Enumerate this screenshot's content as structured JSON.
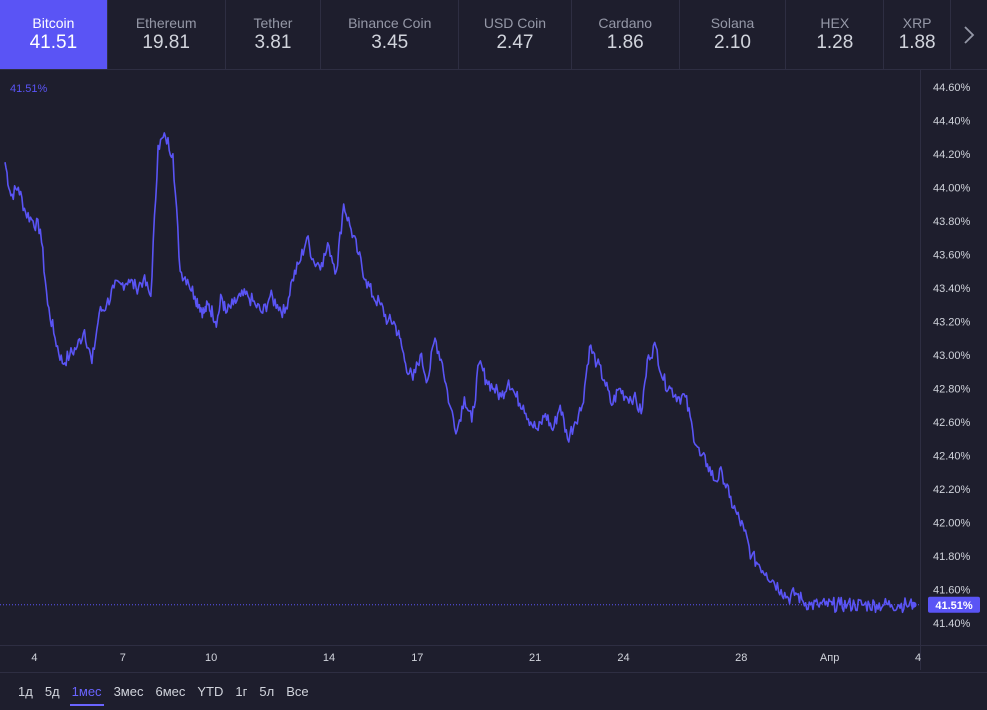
{
  "tabs": [
    {
      "name": "Bitcoin",
      "value": "41.51",
      "active": true
    },
    {
      "name": "Ethereum",
      "value": "19.81",
      "active": false
    },
    {
      "name": "Tether",
      "value": "3.81",
      "active": false
    },
    {
      "name": "Binance Coin",
      "value": "3.45",
      "active": false
    },
    {
      "name": "USD Coin",
      "value": "2.47",
      "active": false
    },
    {
      "name": "Cardano",
      "value": "1.86",
      "active": false
    },
    {
      "name": "Solana",
      "value": "2.10",
      "active": false
    },
    {
      "name": "HEX",
      "value": "1.28",
      "active": false
    },
    {
      "name": "XRP",
      "value": "1.88",
      "active": false
    }
  ],
  "next_icon": "chevron-right-icon",
  "ranges": [
    {
      "label": "1д",
      "active": false
    },
    {
      "label": "5д",
      "active": false
    },
    {
      "label": "1мес",
      "active": true
    },
    {
      "label": "3мес",
      "active": false
    },
    {
      "label": "6мес",
      "active": false
    },
    {
      "label": "YTD",
      "active": false
    },
    {
      "label": "1г",
      "active": false
    },
    {
      "label": "5л",
      "active": false
    },
    {
      "label": "Все",
      "active": false
    }
  ],
  "colors": {
    "line": "#5a54f5",
    "background": "#1e1e2d",
    "grid": "#2e2e42",
    "text": "#d1d4dc",
    "accent": "#5a54f5"
  },
  "chart_data": {
    "type": "line",
    "title": "",
    "xlabel": "",
    "ylabel": "",
    "legend_value": "41.51%",
    "last_value_label": "41.51%",
    "ylim": [
      41.27,
      44.7
    ],
    "xlim": [
      3,
      34.1
    ],
    "y_ticks": [
      "41.40%",
      "41.60%",
      "41.80%",
      "42.00%",
      "42.20%",
      "42.40%",
      "42.60%",
      "42.80%",
      "43.00%",
      "43.20%",
      "43.40%",
      "43.60%",
      "43.80%",
      "44.00%",
      "44.20%",
      "44.40%",
      "44.60%"
    ],
    "x_ticks": [
      {
        "at": 4,
        "label": "4"
      },
      {
        "at": 7,
        "label": "7"
      },
      {
        "at": 10,
        "label": "10"
      },
      {
        "at": 14,
        "label": "14"
      },
      {
        "at": 17,
        "label": "17"
      },
      {
        "at": 21,
        "label": "21"
      },
      {
        "at": 24,
        "label": "24"
      },
      {
        "at": 28,
        "label": "28"
      },
      {
        "at": 31,
        "label": "Апр"
      },
      {
        "at": 34,
        "label": "4"
      }
    ],
    "series": [
      {
        "x": [
          3.0,
          3.2,
          3.45,
          3.7,
          3.95,
          4.2,
          4.45,
          4.7,
          4.95,
          5.2,
          5.45,
          5.7,
          5.95,
          6.2,
          6.45,
          6.7,
          6.95,
          7.2,
          7.45,
          7.7,
          7.95,
          8.2,
          8.45,
          8.7,
          8.95,
          9.2,
          9.45,
          9.6,
          9.75,
          9.9,
          10.05,
          10.2,
          10.35,
          10.5,
          10.75,
          11.0,
          11.25,
          11.5,
          11.75,
          12.0,
          12.25,
          12.5,
          12.75,
          13.0,
          13.25,
          13.5,
          13.75,
          14.0,
          14.25,
          14.5,
          14.75,
          15.0,
          15.25,
          15.5,
          15.75,
          16.0,
          16.2,
          16.4,
          16.6,
          16.85,
          17.1,
          17.35,
          17.6,
          17.85,
          18.1,
          18.35,
          18.6,
          18.85,
          19.1,
          19.35,
          19.6,
          19.85,
          20.1,
          20.35,
          20.6,
          20.85,
          21.1,
          21.35,
          21.6,
          21.85,
          22.1,
          22.35,
          22.6,
          22.85,
          23.1,
          23.35,
          23.6,
          23.85,
          24.1,
          24.35,
          24.6,
          24.85,
          25.1,
          25.35,
          25.6,
          25.85,
          26.1,
          26.35,
          26.6,
          26.85,
          27.1,
          27.35,
          27.6,
          27.85,
          28.1,
          28.35,
          28.6,
          28.85,
          29.1,
          29.35,
          29.6,
          29.85,
          30.1,
          30.35,
          30.6,
          30.85,
          31.1,
          31.35,
          31.6,
          31.85,
          32.1,
          32.35,
          32.6,
          32.85,
          33.1,
          33.35,
          33.6,
          33.85,
          34.1
        ],
        "y": [
          44.15,
          43.95,
          44.0,
          43.85,
          43.8,
          43.75,
          43.3,
          43.1,
          42.95,
          43.0,
          43.05,
          43.15,
          42.95,
          43.25,
          43.3,
          43.4,
          43.42,
          43.45,
          43.4,
          43.45,
          43.35,
          44.25,
          44.3,
          44.2,
          43.5,
          43.45,
          43.35,
          43.3,
          43.25,
          43.3,
          43.25,
          43.2,
          43.35,
          43.25,
          43.3,
          43.35,
          43.35,
          43.3,
          43.25,
          43.35,
          43.3,
          43.25,
          43.45,
          43.55,
          43.7,
          43.55,
          43.55,
          43.65,
          43.5,
          43.9,
          43.75,
          43.6,
          43.45,
          43.35,
          43.3,
          43.2,
          43.2,
          43.1,
          42.95,
          42.85,
          43.0,
          42.85,
          43.1,
          42.95,
          42.7,
          42.55,
          42.75,
          42.6,
          42.95,
          42.85,
          42.8,
          42.75,
          42.85,
          42.75,
          42.7,
          42.6,
          42.55,
          42.65,
          42.55,
          42.7,
          42.5,
          42.6,
          42.7,
          43.05,
          42.95,
          42.85,
          42.7,
          42.8,
          42.75,
          42.75,
          42.65,
          43.0,
          43.05,
          42.85,
          42.8,
          42.75,
          42.75,
          42.55,
          42.4,
          42.35,
          42.25,
          42.3,
          42.15,
          42.05,
          41.95,
          41.8,
          41.75,
          41.7,
          41.65,
          41.6,
          41.55,
          41.58,
          41.53,
          41.51,
          41.51,
          41.51,
          41.51,
          41.51,
          41.51,
          41.51,
          41.51,
          41.51,
          41.51,
          41.51,
          41.51,
          41.51,
          41.51,
          41.51,
          41.51
        ]
      }
    ]
  }
}
